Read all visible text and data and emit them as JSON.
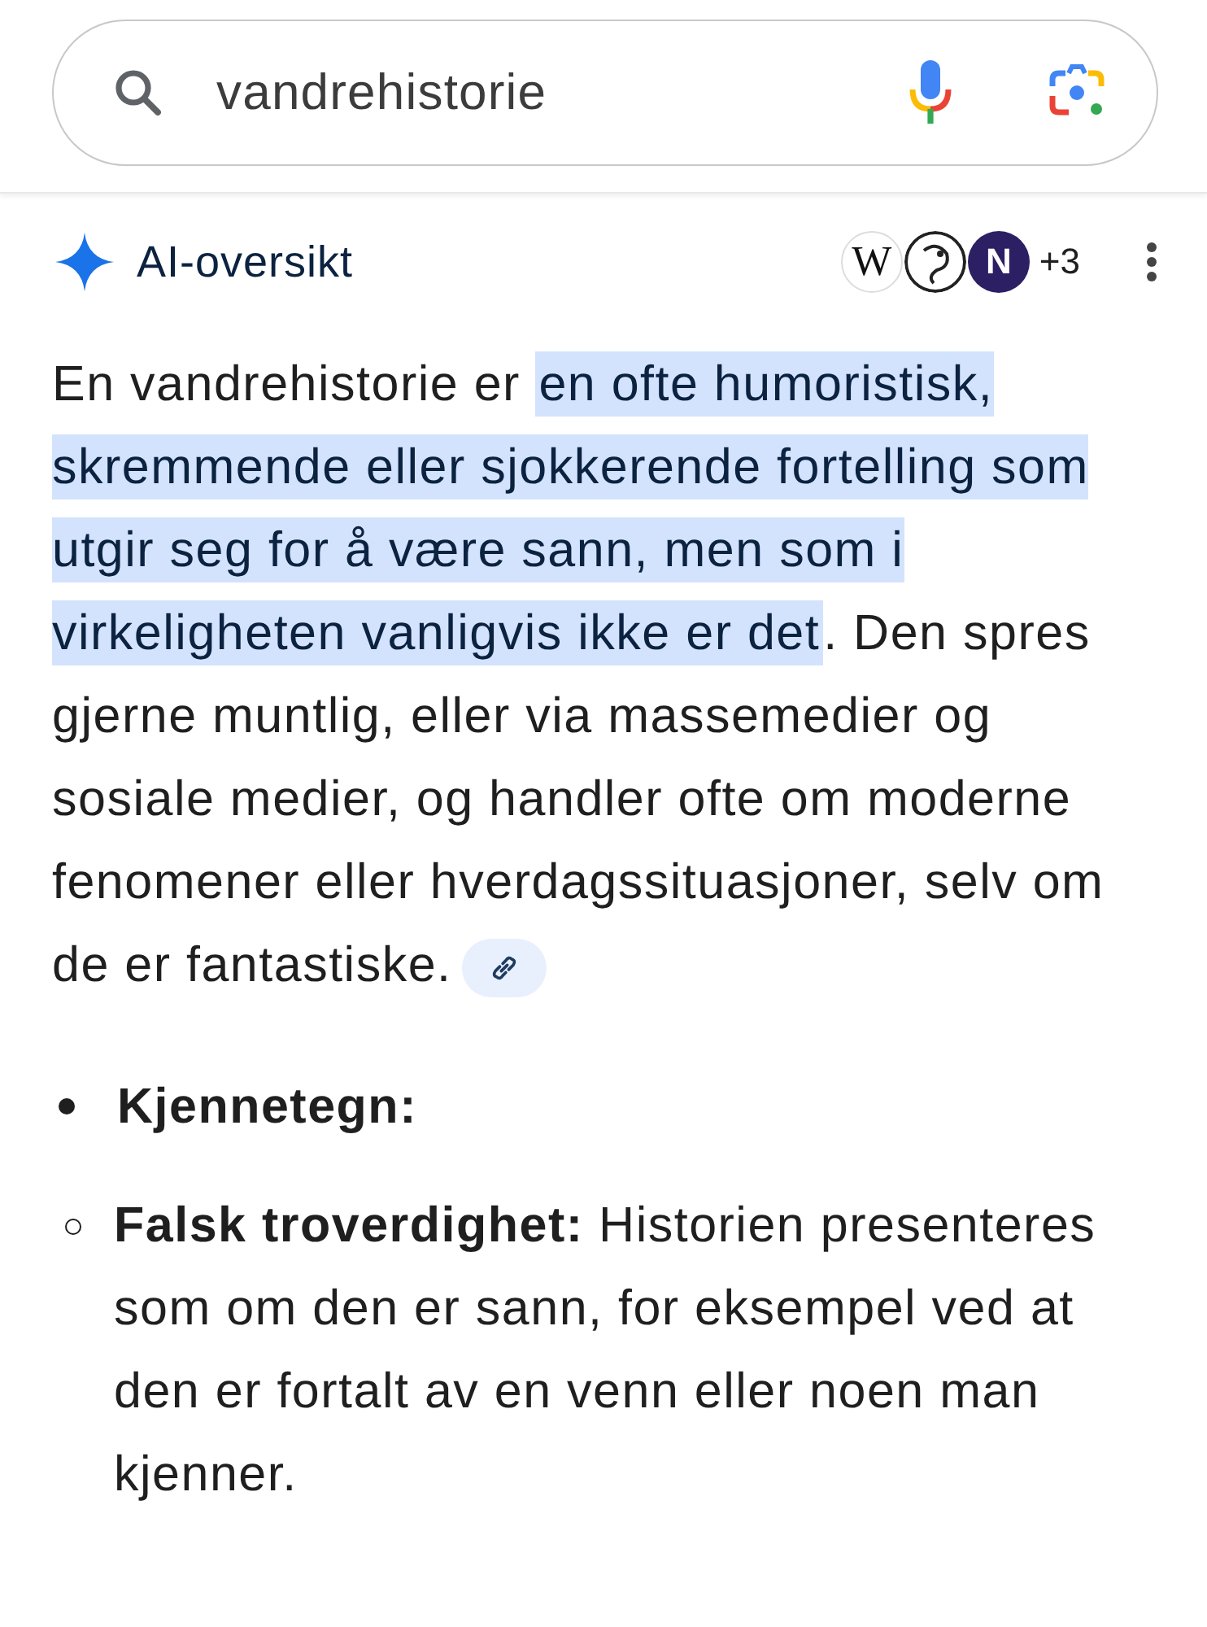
{
  "search": {
    "value": "vandrehistorie"
  },
  "overview": {
    "title": "AI-oversikt",
    "sources": [
      {
        "kind": "letter",
        "text": "W"
      },
      {
        "kind": "logo"
      },
      {
        "kind": "letter",
        "text": "N"
      }
    ],
    "more_sources": "+3",
    "paragraph": [
      {
        "text": "En vandrehistorie er ",
        "highlighted": false
      },
      {
        "text": "en ofte humoristisk, skremmende eller sjokkerende fortelling som utgir seg for å være sann, men som i virkeligheten vanligvis ikke er det",
        "highlighted": true
      },
      {
        "text": ". Den spres gjerne muntlig, eller via massemedier og sosiale medier, og handler ofte om moderne fenomener eller hverdagssituasjoner, selv om de er fantastiske.",
        "highlighted": false
      }
    ],
    "list": [
      {
        "text": "Kjennetegn:",
        "children": [
          {
            "text": "**Falsk troverdighet:** Historien presenteres som om den er sann, for eksempel ved at den er fortalt av en venn eller noen man kjenner."
          }
        ]
      }
    ]
  }
}
